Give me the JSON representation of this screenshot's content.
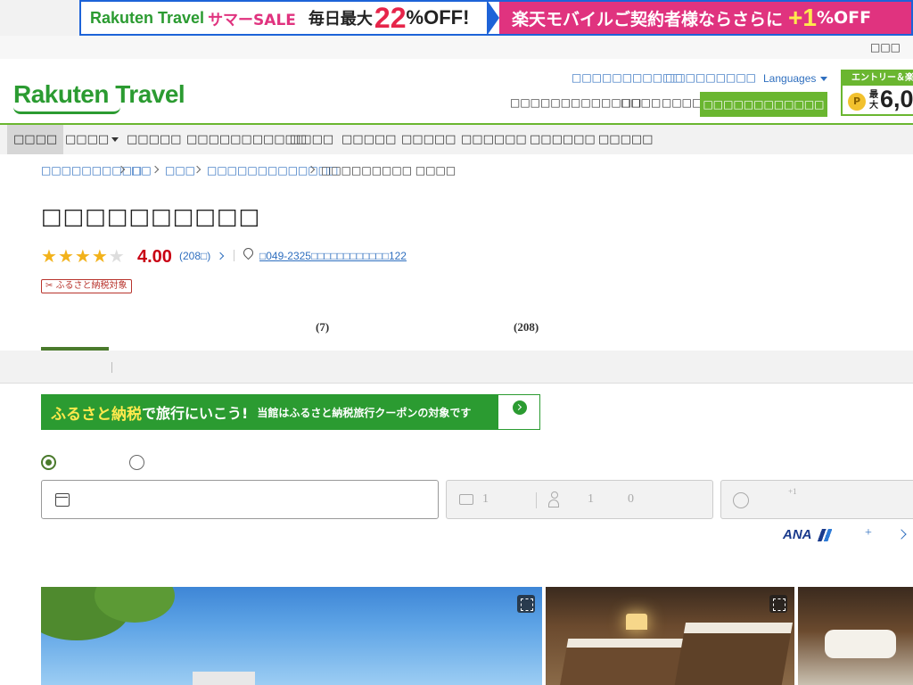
{
  "top_banner": {
    "brand": "Rakuten Travel",
    "sale": "サマーSALE",
    "daily_max": "毎日最大",
    "percent": "22",
    "off": "%OFF!",
    "mobile_text": "楽天モバイルご契約者様ならさらに",
    "plus": "+1",
    "plus_off": "%OFF"
  },
  "util_bar": {
    "link1": "□□□"
  },
  "header": {
    "logo": "Rakuten Travel",
    "top_links": [
      "□□□□□□□□□□□",
      "□□□□□□",
      "□□□"
    ],
    "languages": "Languages",
    "bottom_links": [
      "□□□□□□□□□□□□□",
      "□□□□",
      "□□□□"
    ],
    "cta_button": "□□□□□□□□□□□□",
    "entry": {
      "title": "エントリー＆楽天",
      "max": "最大",
      "amount": "6,0"
    }
  },
  "nav": {
    "items": [
      "□□□□",
      "□□□□",
      "□□□□□",
      "□□□□□□□□□□□",
      "□□□□",
      "□□□□□",
      "□□□□□",
      "□□□□□□",
      "□□□□□□",
      "□□□□□"
    ]
  },
  "breadcrumb": {
    "items": [
      "□□□□□□□□□□",
      "□□",
      "□□□",
      "□□□□□□□□□□□□□",
      "□□□□□□□□□ □□□□"
    ]
  },
  "hotel": {
    "name": "□□□□□□□□□□",
    "rating_value": 4.0,
    "rating": "4.00",
    "reviews": "(208□)",
    "address": "□049-2325□□□□□□□□□□□□122",
    "furusato_tag": "✂ ふるさと納税対象"
  },
  "tabs": {
    "rooms_count": "(7)",
    "reviews_count": "(208)"
  },
  "furusato_banner": {
    "headline_a": "ふるさと納税",
    "headline_b": "で旅行にいこう!",
    "subtext": "当館はふるさと納税旅行クーポンの対象です"
  },
  "search": {
    "rooms": "1",
    "adults": "1",
    "children": "0",
    "coupon_sup": "+1"
  },
  "ana": {
    "logo": "ANA",
    "plus": "+"
  },
  "colors": {
    "brand_green": "#2b9b31",
    "accent_green": "#6ab630",
    "link_blue": "#2f6fbf",
    "rating_red": "#c90014",
    "star": "#f2b21b"
  }
}
